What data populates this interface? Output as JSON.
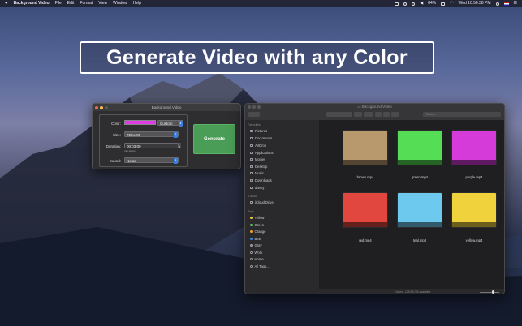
{
  "menubar": {
    "app_name": "Background Video",
    "menus": [
      "File",
      "Edit",
      "Format",
      "View",
      "Window",
      "Help"
    ],
    "battery": "84%",
    "clock": "Wed 10:56:38 PM"
  },
  "banner": {
    "text": "Generate Video with any Color"
  },
  "app_window": {
    "title": "Background Video",
    "color_label": "Color:",
    "color_value": "#e03ae6",
    "color_mode": "Custom",
    "size_label": "Size:",
    "size_value": "720x480",
    "duration_label": "Duration:",
    "duration_value": "00:03:00",
    "duration_hint": "mm:ss:ms",
    "sound_label": "Sound:",
    "sound_value": "Noise",
    "generate_button": "Generate"
  },
  "finder": {
    "title": "Background Video",
    "search_placeholder": "Search",
    "favorites_header": "Favorites",
    "favorites": [
      "Pictures",
      "Documents",
      "AirDrop",
      "Applications",
      "Movies",
      "Desktop",
      "Music",
      "Downloads",
      "danny"
    ],
    "icloud_header": "iCloud",
    "icloud": [
      "iCloud Drive"
    ],
    "tags_header": "Tags",
    "tags": [
      {
        "label": "Yellow",
        "color": "#f5c842"
      },
      {
        "label": "Green",
        "color": "#5ac85a"
      },
      {
        "label": "Orange",
        "color": "#f0a030"
      },
      {
        "label": "Blue",
        "color": "#3a86e8"
      },
      {
        "label": "Gray",
        "color": "#9a9a9e"
      },
      {
        "label": "Work",
        "color": "#2a2a2c"
      },
      {
        "label": "Home",
        "color": "#2a2a2c"
      },
      {
        "label": "All Tags...",
        "color": "#2a2a2c"
      }
    ],
    "files": [
      {
        "name": "brown.mp4",
        "color": "#b8996d"
      },
      {
        "name": "green.mp4",
        "color": "#54dd55"
      },
      {
        "name": "purple.mp4",
        "color": "#d53bd8"
      },
      {
        "name": "red.mp4",
        "color": "#e2473f"
      },
      {
        "name": "teal.mp4",
        "color": "#6ec9ee"
      },
      {
        "name": "yellow.mp4",
        "color": "#f0d33c"
      }
    ],
    "status": "6 items, 125.55 GB available"
  }
}
